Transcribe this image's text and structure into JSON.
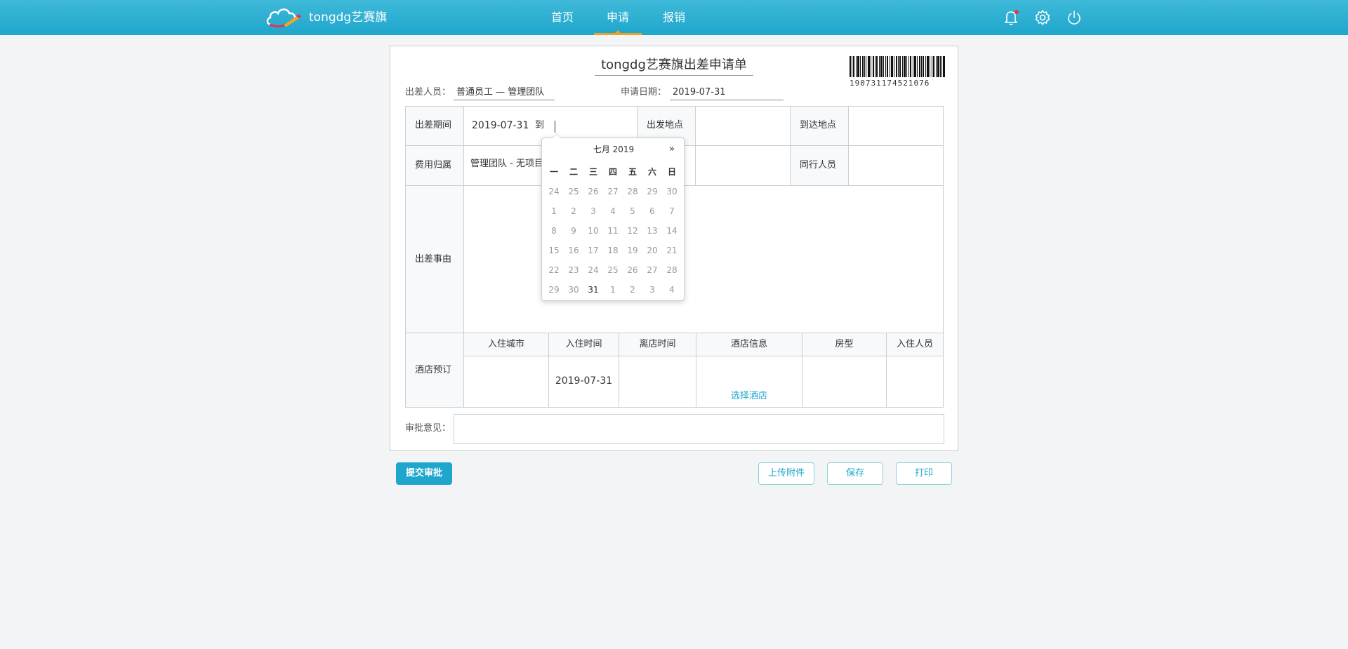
{
  "header": {
    "brand": "tongdg艺赛旗",
    "nav": [
      "首页",
      "申请",
      "报销"
    ],
    "active_nav": "申请",
    "icons": [
      "bell-icon",
      "gear-icon",
      "power-icon"
    ],
    "accent_color": "#1ea6cc"
  },
  "form": {
    "title": "tongdg艺赛旗出差申请单",
    "barcode_number": "190731174521076",
    "traveler_label": "出差人员：",
    "traveler_value": "普通员工 — 管理团队",
    "apply_date_label": "申请日期：",
    "apply_date_value": "2019-07-31",
    "period_label": "出差期间",
    "period_start": "2019-07-31",
    "period_to": "到",
    "depart_label": "出发地点",
    "arrive_label": "到达地点",
    "cost_label": "费用归属",
    "cost_value": "管理团队 - 无项目",
    "companion_label": "同行人员",
    "reason_label": "出差事由",
    "hotel_label": "酒店预订",
    "hotel_columns": [
      "入住城市",
      "入住时间",
      "离店时间",
      "酒店信息",
      "房型",
      "入住人员"
    ],
    "hotel_checkin": "2019-07-31",
    "hotel_select": "选择酒店",
    "approval_label": "审批意见："
  },
  "datepicker": {
    "title": "七月 2019",
    "next": "»",
    "weekdays": [
      "一",
      "二",
      "三",
      "四",
      "五",
      "六",
      "日"
    ],
    "weeks": [
      [
        "24",
        "25",
        "26",
        "27",
        "28",
        "29",
        "30"
      ],
      [
        "1",
        "2",
        "3",
        "4",
        "5",
        "6",
        "7"
      ],
      [
        "8",
        "9",
        "10",
        "11",
        "12",
        "13",
        "14"
      ],
      [
        "15",
        "16",
        "17",
        "18",
        "19",
        "20",
        "21"
      ],
      [
        "22",
        "23",
        "24",
        "25",
        "26",
        "27",
        "28"
      ],
      [
        "29",
        "30",
        "31",
        "1",
        "2",
        "3",
        "4"
      ]
    ],
    "enabled_day": "31"
  },
  "buttons": {
    "submit": "提交审批",
    "upload": "上传附件",
    "save": "保存",
    "print": "打印"
  }
}
